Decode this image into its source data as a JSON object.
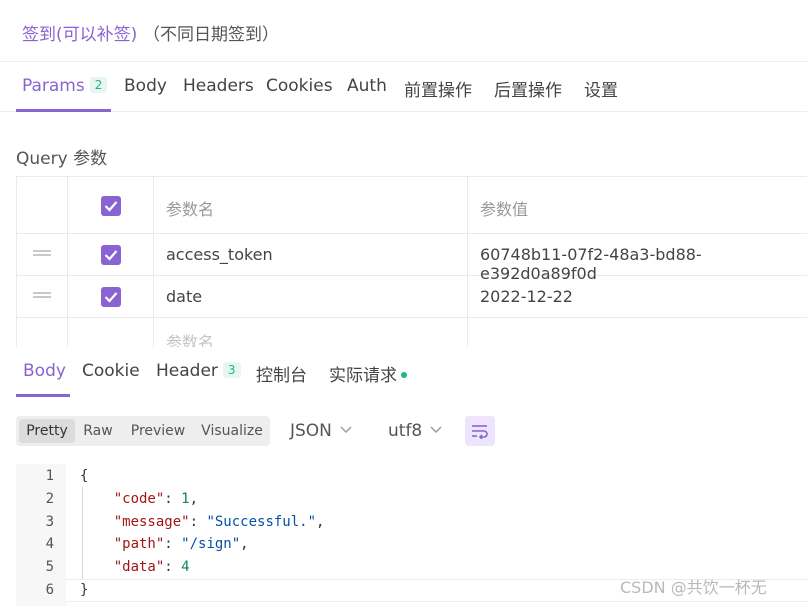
{
  "request": {
    "title_link": "签到(可以补签)",
    "title_note": "（不同日期签到）",
    "tabs": [
      {
        "label": "Params",
        "badge": "2"
      },
      {
        "label": "Body"
      },
      {
        "label": "Headers"
      },
      {
        "label": "Cookies"
      },
      {
        "label": "Auth"
      },
      {
        "label": "前置操作"
      },
      {
        "label": "后置操作"
      },
      {
        "label": "设置"
      }
    ],
    "active_tab": "Params"
  },
  "query": {
    "label": "Query 参数",
    "header": {
      "name": "参数名",
      "value": "参数值"
    },
    "rows": [
      {
        "checked": true,
        "name": "access_token",
        "value": "60748b11-07f2-48a3-bd88-e392d0a89f0d"
      },
      {
        "checked": true,
        "name": "date",
        "value": "2022-12-22"
      }
    ],
    "new_row_placeholder": "参数名"
  },
  "response": {
    "tabs": [
      {
        "label": "Body"
      },
      {
        "label": "Cookie"
      },
      {
        "label": "Header",
        "badge": "3"
      },
      {
        "label": "控制台"
      },
      {
        "label": "实际请求"
      }
    ],
    "active_tab": "Body",
    "format_buttons": [
      "Pretty",
      "Raw",
      "Preview",
      "Visualize"
    ],
    "active_format": "Pretty",
    "content_type": "JSON",
    "encoding": "utf8",
    "code_lines": [
      "{",
      "    \"code\": 1,",
      "    \"message\": \"Successful.\",",
      "    \"path\": \"/sign\",",
      "    \"data\": 4",
      "}"
    ],
    "line_numbers": [
      "1",
      "2",
      "3",
      "4",
      "5",
      "6"
    ]
  },
  "watermark": "CSDN @共饮一杯无",
  "colors": {
    "accent": "#8a63d2",
    "success": "#20b589"
  }
}
